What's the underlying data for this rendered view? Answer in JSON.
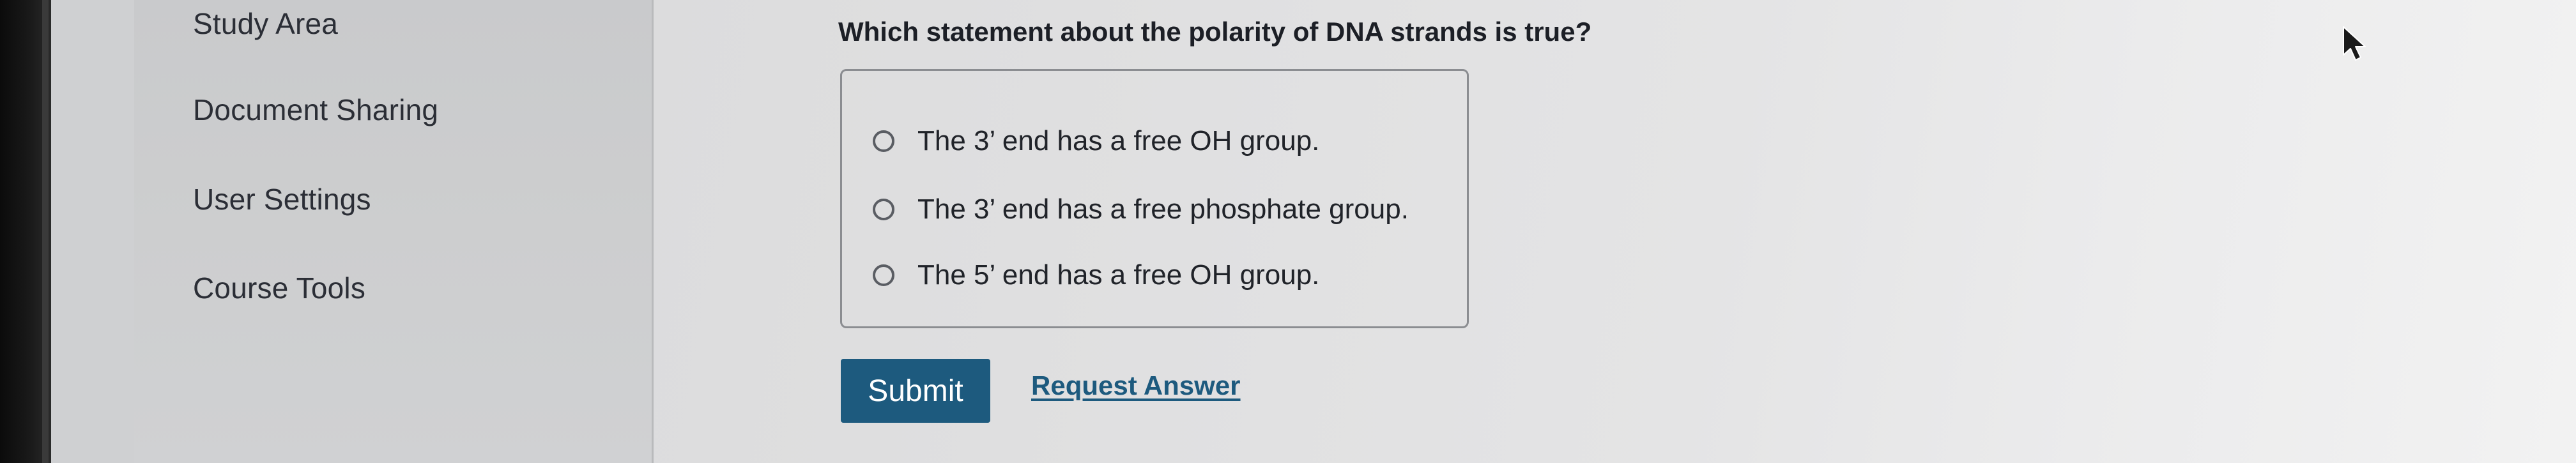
{
  "sidebar": {
    "items": [
      {
        "label": "Study Area"
      },
      {
        "label": "Document Sharing"
      },
      {
        "label": "User Settings"
      },
      {
        "label": "Course Tools"
      }
    ]
  },
  "question": {
    "text": "Which statement about the polarity of DNA strands is true?",
    "options": [
      {
        "label": "The 3’ end has a free OH group."
      },
      {
        "label": "The 3’ end has a free phosphate group."
      },
      {
        "label": "The 5’ end has a free OH group."
      }
    ]
  },
  "actions": {
    "submit_label": "Submit",
    "request_answer_label": "Request Answer"
  },
  "colors": {
    "accent": "#1d5a7e",
    "sidebar_bg": "#cbcccd",
    "main_bg": "#e3e3e4"
  },
  "icons": {
    "cursor": "mouse-pointer-icon"
  }
}
